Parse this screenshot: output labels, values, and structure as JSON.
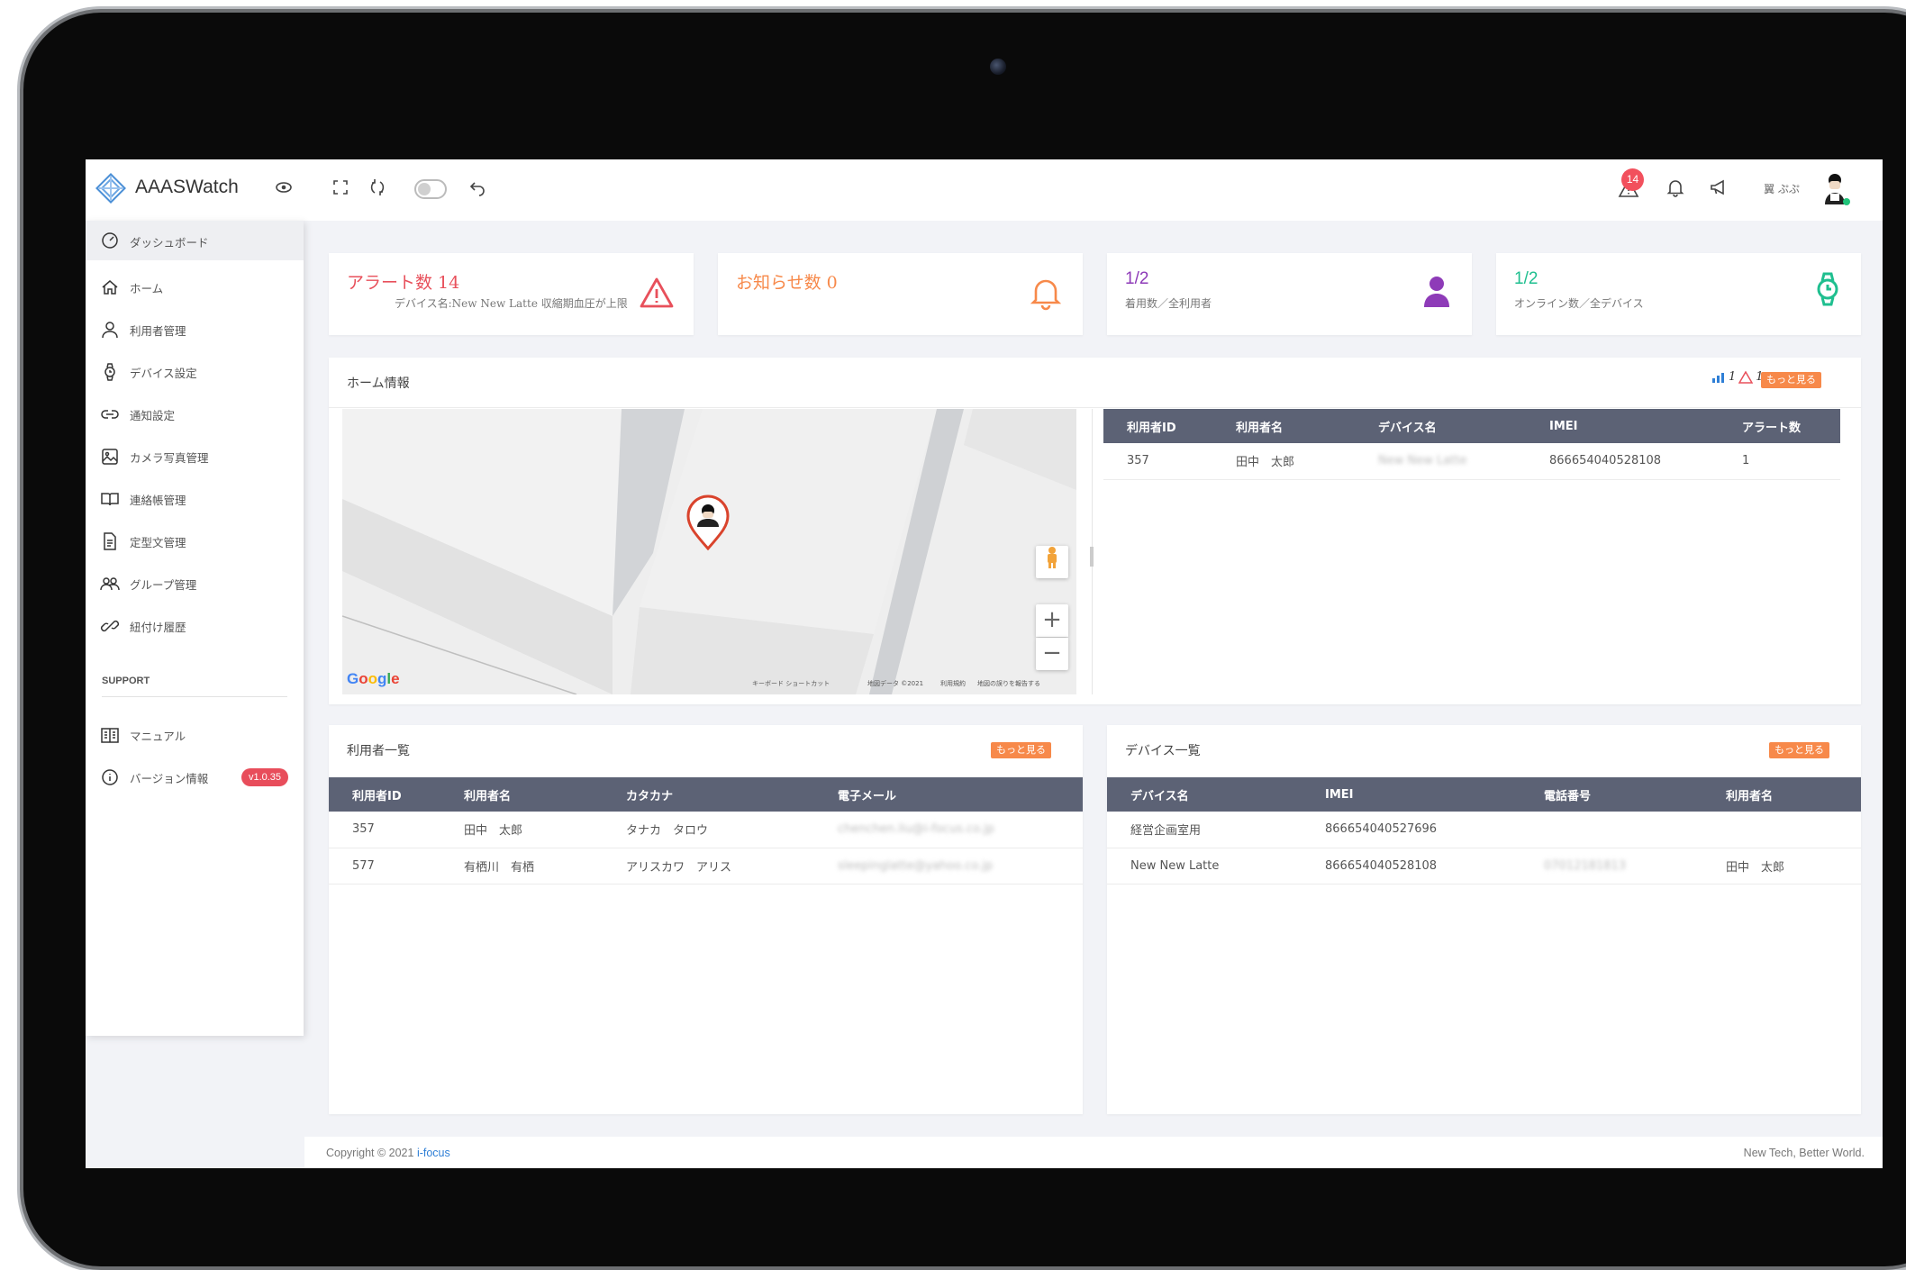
{
  "app": {
    "brand": "AAASWatch",
    "notification_count": "14",
    "header_glyphs": "翼 ぷぷ"
  },
  "sidebar": {
    "header": "ダッシュボード",
    "items": [
      {
        "label": "ホーム",
        "icon": "home-icon"
      },
      {
        "label": "利用者管理",
        "icon": "user-icon"
      },
      {
        "label": "デバイス設定",
        "icon": "watch-icon"
      },
      {
        "label": "通知設定",
        "icon": "link-icon"
      },
      {
        "label": "カメラ写真管理",
        "icon": "image-icon"
      },
      {
        "label": "連絡帳管理",
        "icon": "book-icon"
      },
      {
        "label": "定型文管理",
        "icon": "document-icon"
      },
      {
        "label": "グループ管理",
        "icon": "group-icon"
      },
      {
        "label": "紐付け履歴",
        "icon": "chain-icon"
      }
    ],
    "section": "SUPPORT",
    "support_items": [
      {
        "label": "マニュアル",
        "icon": "manual-icon"
      },
      {
        "label": "バージョン情報",
        "icon": "info-icon",
        "badge": "v1.0.35"
      }
    ]
  },
  "stats": {
    "alerts": {
      "title": "アラート数 14",
      "sub": "デバイス名:New New Latte 収縮期血圧が上限",
      "color": "#e8505b"
    },
    "notices": {
      "title": "お知らせ数 0",
      "color": "#f7894a"
    },
    "wearing": {
      "value": "1/2",
      "sub": "着用数／全利用者",
      "color": "#8e3bb8"
    },
    "online": {
      "value": "1/2",
      "sub": "オンライン数／全デバイス",
      "color": "#1fbf8f"
    }
  },
  "home_info": {
    "title": "ホーム情報",
    "summary_count_a": "1",
    "summary_count_b": "1",
    "more": "もっと見る",
    "columns": [
      "利用者ID",
      "利用者名",
      "デバイス名",
      "IMEI",
      "アラート数"
    ],
    "rows": [
      [
        "357",
        "田中　太郎",
        "New New Latte",
        "866654040528108",
        "1"
      ]
    ]
  },
  "map": {
    "provider": "Google",
    "footer_links": [
      "キーボード ショートカット",
      "地図データ ©2021",
      "利用規約",
      "地図の誤りを報告する"
    ],
    "zoom_in": "+",
    "zoom_out": "−"
  },
  "users": {
    "title": "利用者一覧",
    "more": "もっと見る",
    "columns": [
      "利用者ID",
      "利用者名",
      "カタカナ",
      "電子メール"
    ],
    "rows": [
      [
        "357",
        "田中　太郎",
        "タナカ　タロウ",
        "chenchen.liu@i-focus.co.jp"
      ],
      [
        "577",
        "有栖川　有栖",
        "アリスカワ　アリス",
        "sleepinglatte@yahoo.co.jp"
      ]
    ]
  },
  "devices": {
    "title": "デバイス一覧",
    "more": "もっと見る",
    "columns": [
      "デバイス名",
      "IMEI",
      "電話番号",
      "利用者名"
    ],
    "rows": [
      [
        "経営企画室用",
        "866654040527696",
        "",
        ""
      ],
      [
        "New New Latte",
        "866654040528108",
        "07012181813",
        "田中　太郎"
      ]
    ]
  },
  "footer": {
    "copyright": "Copyright © 2021 ",
    "company": "i-focus",
    "tagline": "New Tech, Better World."
  }
}
